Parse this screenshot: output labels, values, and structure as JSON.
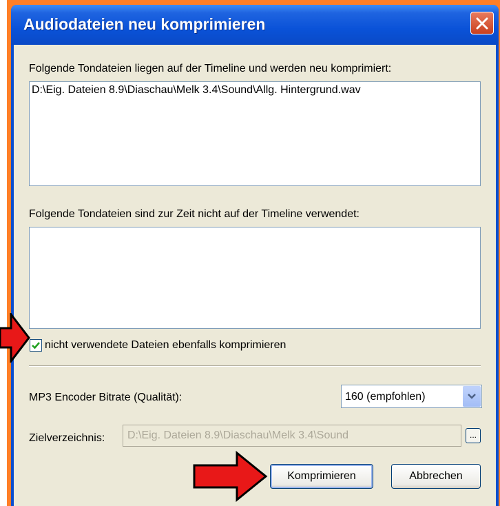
{
  "window": {
    "title": "Audiodateien neu komprimieren"
  },
  "section_used": {
    "label": "Folgende Tondateien liegen auf der Timeline und werden neu komprimiert:",
    "items": [
      "D:\\Eig. Dateien 8.9\\Diaschau\\Melk 3.4\\Sound\\Allg. Hintergrund.wav"
    ]
  },
  "section_unused": {
    "label": "Folgende Tondateien sind zur Zeit nicht auf der Timeline verwendet:",
    "items": []
  },
  "checkbox": {
    "label": "nicht verwendete Dateien ebenfalls komprimieren",
    "checked": true
  },
  "bitrate": {
    "label": "MP3 Encoder Bitrate (Qualität):",
    "selected": "160 (empfohlen)"
  },
  "target": {
    "label": "Zielverzeichnis:",
    "value": "D:\\Eig. Dateien 8.9\\Diaschau\\Melk 3.4\\Sound",
    "browse_label": "..."
  },
  "buttons": {
    "compress": "Komprimieren",
    "cancel": "Abbrechen"
  },
  "colors": {
    "frame": "#ff7f27",
    "titlebar": "#0a52d8",
    "dialog_bg": "#ece9d8",
    "arrow": "#e81818"
  },
  "icons": [
    "close-icon",
    "checkmark-icon",
    "chevron-down-icon",
    "red-arrow-icon"
  ]
}
